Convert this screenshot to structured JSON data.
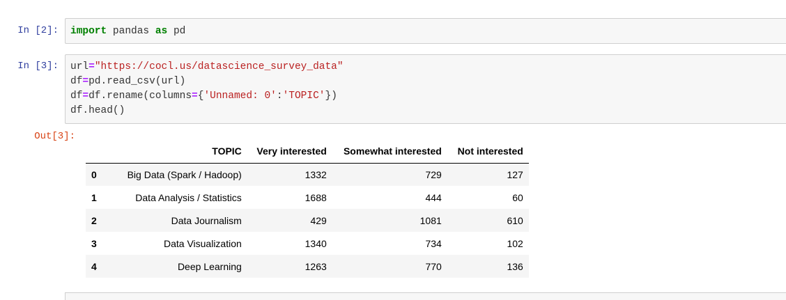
{
  "cells": [
    {
      "prompt": "In [2]:",
      "code": {
        "kw_import": "import",
        "module": " pandas ",
        "kw_as": "as",
        "alias": " pd"
      }
    },
    {
      "prompt": "In [3]:",
      "lines": {
        "l1_var": "url",
        "l1_eq": "=",
        "l1_str": "\"https://cocl.us/datascience_survey_data\"",
        "l2_var": "df",
        "l2_eq": "=",
        "l2_rest": "pd.read_csv(url)",
        "l3_var": "df",
        "l3_eq": "=",
        "l3_call": "df.rename(columns",
        "l3_eq2": "=",
        "l3_brace": "{",
        "l3_key": "'Unnamed: 0'",
        "l3_colon": ":",
        "l3_val": "'TOPIC'",
        "l3_end": "})",
        "l4": "df.head()"
      }
    }
  ],
  "output": {
    "prompt": "Out[3]:",
    "columns": [
      "",
      "TOPIC",
      "Very interested",
      "Somewhat interested",
      "Not interested"
    ],
    "rows": [
      [
        "0",
        "Big Data (Spark / Hadoop)",
        "1332",
        "729",
        "127"
      ],
      [
        "1",
        "Data Analysis / Statistics",
        "1688",
        "444",
        "60"
      ],
      [
        "2",
        "Data Journalism",
        "429",
        "1081",
        "610"
      ],
      [
        "3",
        "Data Visualization",
        "1340",
        "734",
        "102"
      ],
      [
        "4",
        "Deep Learning",
        "1263",
        "770",
        "136"
      ]
    ]
  }
}
